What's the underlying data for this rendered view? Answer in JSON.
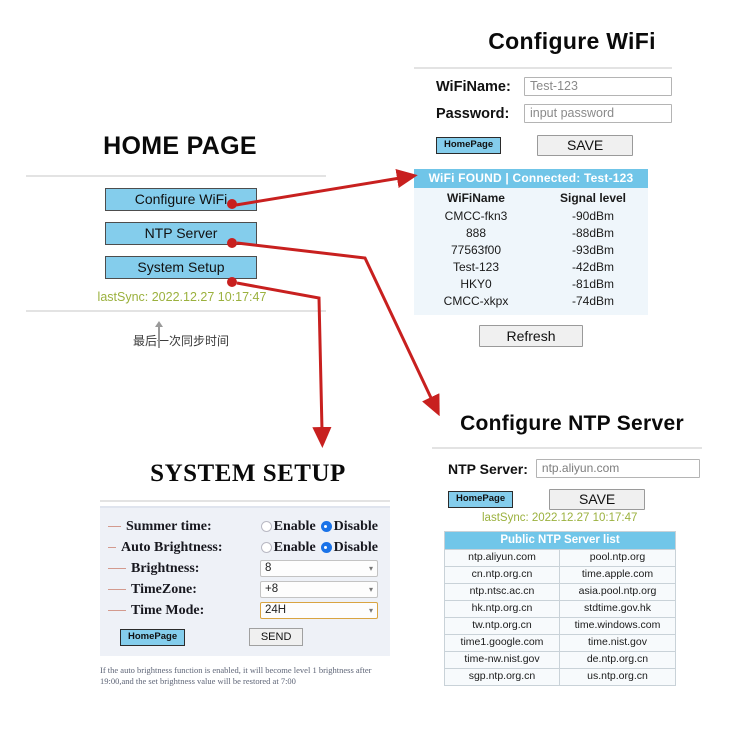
{
  "home": {
    "title": "HOME PAGE",
    "buttons": [
      {
        "label": "Configure WiFi"
      },
      {
        "label": "NTP Server"
      },
      {
        "label": "System Setup"
      }
    ],
    "last_sync": "lastSync: 2022.12.27 10:17:47",
    "annotation_cn": "最后一次同步时间"
  },
  "wifi": {
    "title": "Configure WiFi",
    "fields": [
      {
        "label": "WiFiName:",
        "value": "Test-123"
      },
      {
        "label": "Password:",
        "value": "input password"
      }
    ],
    "homepage_label": "HomePage",
    "save_label": "SAVE",
    "found_header": "WiFi FOUND  |  Connected: Test-123",
    "table_headers": [
      "WiFiName",
      "Signal level"
    ],
    "networks": [
      {
        "name": "CMCC-fkn3",
        "signal": "-90dBm"
      },
      {
        "name": "888",
        "signal": "-88dBm"
      },
      {
        "name": "77563f00",
        "signal": "-93dBm"
      },
      {
        "name": "Test-123",
        "signal": "-42dBm"
      },
      {
        "name": "HKY0",
        "signal": "-81dBm"
      },
      {
        "name": "CMCC-xkpx",
        "signal": "-74dBm"
      }
    ],
    "refresh_label": "Refresh"
  },
  "system_setup": {
    "title": "SYSTEM SETUP",
    "rows": [
      {
        "label": "Summer time:",
        "type": "radio",
        "options": [
          "Enable",
          "Disable"
        ],
        "selected": "Disable"
      },
      {
        "label": "Auto Brightness:",
        "type": "radio",
        "options": [
          "Enable",
          "Disable"
        ],
        "selected": "Disable"
      },
      {
        "label": "Brightness:",
        "type": "select",
        "value": "8"
      },
      {
        "label": "TimeZone:",
        "type": "select",
        "value": "+8"
      },
      {
        "label": "Time Mode:",
        "type": "select",
        "value": "24H",
        "focused": true
      }
    ],
    "homepage_label": "HomePage",
    "send_label": "SEND",
    "note": "If the auto brightness function is enabled, it will become level 1 brightness after 19:00,and the set brightness value will be restored at 7:00"
  },
  "ntp": {
    "title": "Configure NTP Server",
    "field_label": "NTP Server:",
    "field_value": "ntp.aliyun.com",
    "homepage_label": "HomePage",
    "save_label": "SAVE",
    "last_sync": "lastSync: 2022.12.27 10:17:47",
    "list_header": "Public NTP Server list",
    "servers": [
      [
        "ntp.aliyun.com",
        "pool.ntp.org"
      ],
      [
        "cn.ntp.org.cn",
        "time.apple.com"
      ],
      [
        "ntp.ntsc.ac.cn",
        "asia.pool.ntp.org"
      ],
      [
        "hk.ntp.org.cn",
        "stdtime.gov.hk"
      ],
      [
        "tw.ntp.org.cn",
        "time.windows.com"
      ],
      [
        "time1.google.com",
        "time.nist.gov"
      ],
      [
        "time-nw.nist.gov",
        "de.ntp.org.cn"
      ],
      [
        "sgp.ntp.org.cn",
        "us.ntp.org.cn"
      ]
    ]
  },
  "colors": {
    "arrow_red": "#c8201f",
    "button_blue": "#84cdec",
    "header_blue": "#70c5e8",
    "sync_green": "#9bb13e",
    "radio_blue": "#1a73e8",
    "focus_orange": "#d9a441"
  }
}
